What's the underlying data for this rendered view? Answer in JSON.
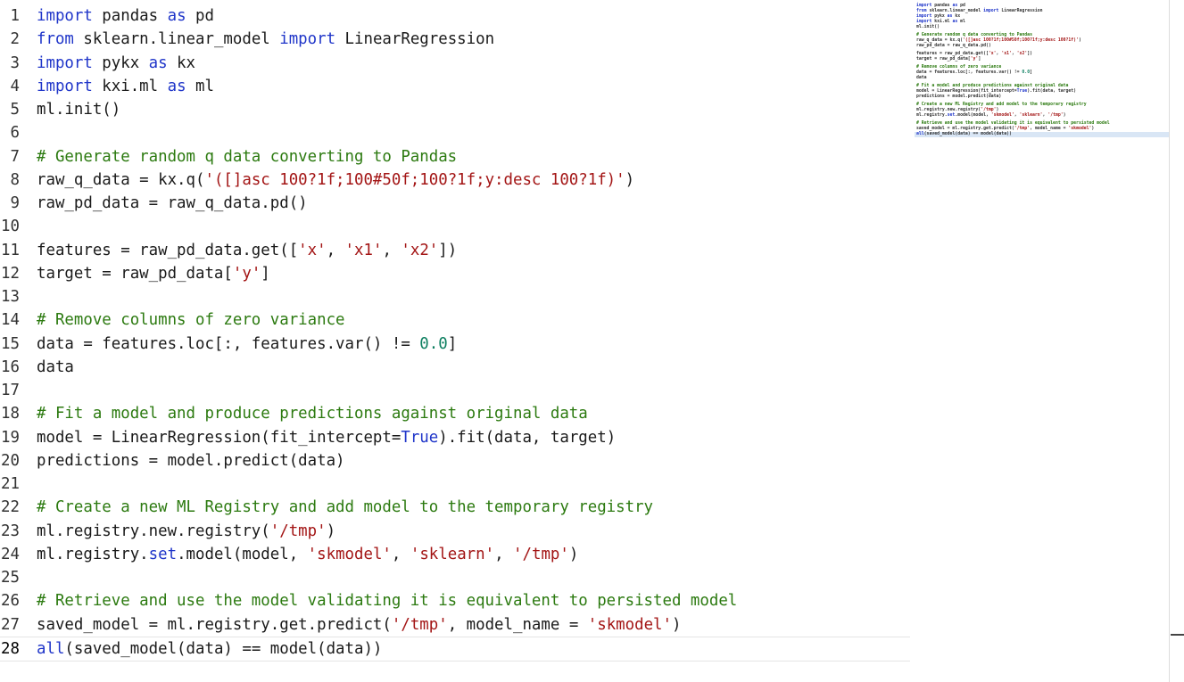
{
  "editor": {
    "active_line": 28,
    "lines": [
      {
        "n": "1",
        "t": [
          {
            "c": "kw",
            "v": "import"
          },
          {
            "c": "",
            "v": " pandas "
          },
          {
            "c": "kw",
            "v": "as"
          },
          {
            "c": "",
            "v": " pd"
          }
        ]
      },
      {
        "n": "2",
        "t": [
          {
            "c": "kw",
            "v": "from"
          },
          {
            "c": "",
            "v": " sklearn.linear_model "
          },
          {
            "c": "kw",
            "v": "import"
          },
          {
            "c": "",
            "v": " LinearRegression"
          }
        ]
      },
      {
        "n": "3",
        "t": [
          {
            "c": "kw",
            "v": "import"
          },
          {
            "c": "",
            "v": " pykx "
          },
          {
            "c": "kw",
            "v": "as"
          },
          {
            "c": "",
            "v": " kx"
          }
        ]
      },
      {
        "n": "4",
        "t": [
          {
            "c": "kw",
            "v": "import"
          },
          {
            "c": "",
            "v": " kxi.ml "
          },
          {
            "c": "kw",
            "v": "as"
          },
          {
            "c": "",
            "v": " ml"
          }
        ]
      },
      {
        "n": "5",
        "t": [
          {
            "c": "",
            "v": "ml.init()"
          }
        ]
      },
      {
        "n": "6",
        "t": []
      },
      {
        "n": "7",
        "t": [
          {
            "c": "cmt",
            "v": "# Generate random q data converting to Pandas"
          }
        ]
      },
      {
        "n": "8",
        "t": [
          {
            "c": "",
            "v": "raw_q_data = kx.q("
          },
          {
            "c": "str",
            "v": "'([]asc 100?1f;100#50f;100?1f;y:desc 100?1f)'"
          },
          {
            "c": "",
            "v": ")"
          }
        ]
      },
      {
        "n": "9",
        "t": [
          {
            "c": "",
            "v": "raw_pd_data = raw_q_data.pd()"
          }
        ]
      },
      {
        "n": "10",
        "t": []
      },
      {
        "n": "11",
        "t": [
          {
            "c": "",
            "v": "features = raw_pd_data.get(["
          },
          {
            "c": "str",
            "v": "'x'"
          },
          {
            "c": "",
            "v": ", "
          },
          {
            "c": "str",
            "v": "'x1'"
          },
          {
            "c": "",
            "v": ", "
          },
          {
            "c": "str",
            "v": "'x2'"
          },
          {
            "c": "",
            "v": "])"
          }
        ]
      },
      {
        "n": "12",
        "t": [
          {
            "c": "",
            "v": "target = raw_pd_data["
          },
          {
            "c": "str",
            "v": "'y'"
          },
          {
            "c": "",
            "v": "]"
          }
        ]
      },
      {
        "n": "13",
        "t": []
      },
      {
        "n": "14",
        "t": [
          {
            "c": "cmt",
            "v": "# Remove columns of zero variance"
          }
        ]
      },
      {
        "n": "15",
        "t": [
          {
            "c": "",
            "v": "data = features.loc[:, features.var() != "
          },
          {
            "c": "num",
            "v": "0.0"
          },
          {
            "c": "",
            "v": "]"
          }
        ]
      },
      {
        "n": "16",
        "t": [
          {
            "c": "",
            "v": "data"
          }
        ]
      },
      {
        "n": "17",
        "t": []
      },
      {
        "n": "18",
        "t": [
          {
            "c": "cmt",
            "v": "# Fit a model and produce predictions against original data"
          }
        ]
      },
      {
        "n": "19",
        "t": [
          {
            "c": "",
            "v": "model = LinearRegression(fit_intercept="
          },
          {
            "c": "kw",
            "v": "True"
          },
          {
            "c": "",
            "v": ").fit(data, target)"
          }
        ]
      },
      {
        "n": "20",
        "t": [
          {
            "c": "",
            "v": "predictions = model.predict(data)"
          }
        ]
      },
      {
        "n": "21",
        "t": []
      },
      {
        "n": "22",
        "t": [
          {
            "c": "cmt",
            "v": "# Create a new ML Registry and add model to the temporary registry"
          }
        ]
      },
      {
        "n": "23",
        "t": [
          {
            "c": "",
            "v": "ml.registry.new.registry("
          },
          {
            "c": "str",
            "v": "'/tmp'"
          },
          {
            "c": "",
            "v": ")"
          }
        ]
      },
      {
        "n": "24",
        "t": [
          {
            "c": "",
            "v": "ml.registry."
          },
          {
            "c": "kw",
            "v": "set"
          },
          {
            "c": "",
            "v": ".model(model, "
          },
          {
            "c": "str",
            "v": "'skmodel'"
          },
          {
            "c": "",
            "v": ", "
          },
          {
            "c": "str",
            "v": "'sklearn'"
          },
          {
            "c": "",
            "v": ", "
          },
          {
            "c": "str",
            "v": "'/tmp'"
          },
          {
            "c": "",
            "v": ")"
          }
        ]
      },
      {
        "n": "25",
        "t": []
      },
      {
        "n": "26",
        "t": [
          {
            "c": "cmt",
            "v": "# Retrieve and use the model validating it is equivalent to persisted model"
          }
        ]
      },
      {
        "n": "27",
        "t": [
          {
            "c": "",
            "v": "saved_model = ml.registry.get.predict("
          },
          {
            "c": "str",
            "v": "'/tmp'"
          },
          {
            "c": "",
            "v": ", model_name = "
          },
          {
            "c": "str",
            "v": "'skmodel'"
          },
          {
            "c": "",
            "v": ")"
          }
        ]
      },
      {
        "n": "28",
        "t": [
          {
            "c": "kw",
            "v": "all"
          },
          {
            "c": "",
            "v": "(saved_model(data) == model(data))"
          }
        ]
      }
    ]
  },
  "colors": {
    "keyword": "#1f35c9",
    "string": "#a31515",
    "comment": "#2c7a10",
    "number": "#0d7f60",
    "minimap_highlight": "#d9e6f5"
  }
}
